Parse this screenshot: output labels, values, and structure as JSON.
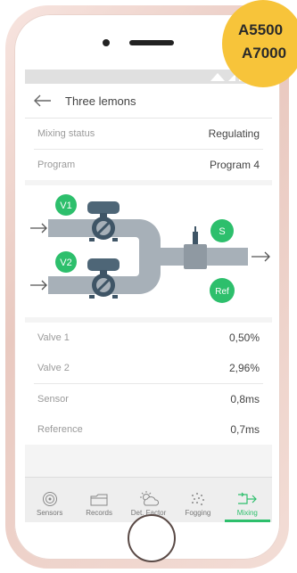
{
  "badge": {
    "line1": "A5500",
    "line2": "A7000"
  },
  "header": {
    "title": "Three lemons"
  },
  "status_rows": [
    {
      "label": "Mixing status",
      "value": "Regulating"
    },
    {
      "label": "Program",
      "value": "Program 4"
    }
  ],
  "diagram": {
    "v1": "V1",
    "v2": "V2",
    "s": "S",
    "ref": "Ref"
  },
  "valves": [
    {
      "label": "Valve 1",
      "value": "0,50%"
    },
    {
      "label": "Valve 2",
      "value": "2,96%"
    }
  ],
  "sensors": [
    {
      "label": "Sensor",
      "value": "0,8ms"
    },
    {
      "label": "Reference",
      "value": "0,7ms"
    }
  ],
  "tabs": [
    {
      "label": "Sensors",
      "icon": "target-icon"
    },
    {
      "label": "Records",
      "icon": "folder-icon"
    },
    {
      "label": "Det. Factor",
      "icon": "weather-icon"
    },
    {
      "label": "Fogging",
      "icon": "fog-icon"
    },
    {
      "label": "Mixing",
      "icon": "mixing-icon"
    }
  ],
  "colors": {
    "accent": "#2dbf6c",
    "badge": "#f7c43a",
    "pipe": "#a7b0b8",
    "valve": "#3f5566"
  }
}
